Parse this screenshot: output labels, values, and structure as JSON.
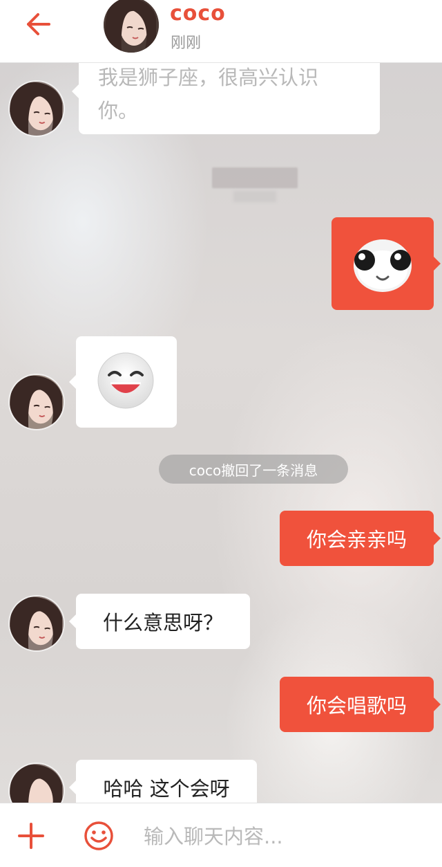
{
  "header": {
    "contact_name": "coco",
    "status": "刚刚"
  },
  "messages": {
    "m1_text_line1": "我是狮子座，很高兴认识",
    "m1_text_line2": "你。",
    "recall_notice": "coco撤回了一条消息",
    "m4_text": "你会亲亲吗",
    "m5_text": "什么意思呀？",
    "m6_text": "你会唱歌吗",
    "m7_text": "哈哈 这个会呀"
  },
  "input": {
    "placeholder": "输入聊天内容..."
  },
  "colors": {
    "accent": "#e8503a",
    "outgoing_bubble": "#f0523c",
    "incoming_bubble": "#ffffff"
  },
  "icons": {
    "back": "arrow-left-icon",
    "plus": "plus-icon",
    "emoji": "smiley-icon",
    "sticker_panda": "panda-face-sticker",
    "sticker_smile": "laughing-face-sticker"
  }
}
